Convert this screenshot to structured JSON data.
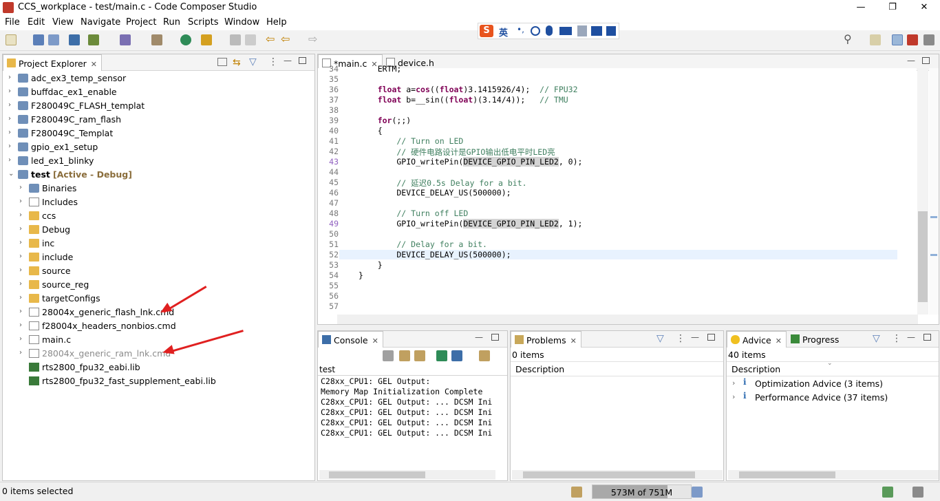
{
  "window": {
    "title": "CCS_workplace - test/main.c - Code Composer Studio"
  },
  "menu": [
    "File",
    "Edit",
    "View",
    "Navigate",
    "Project",
    "Run",
    "Scripts",
    "Window",
    "Help"
  ],
  "project_explorer": {
    "tab_label": "Project Explorer",
    "items": [
      {
        "label": "adc_ex3_temp_sensor",
        "level": 0,
        "icon": "project-icon"
      },
      {
        "label": "buffdac_ex1_enable",
        "level": 0,
        "icon": "project-icon"
      },
      {
        "label": "F280049C_FLASH_templat",
        "level": 0,
        "icon": "project-icon"
      },
      {
        "label": "F280049C_ram_flash",
        "level": 0,
        "icon": "project-icon"
      },
      {
        "label": "F280049C_Templat",
        "level": 0,
        "icon": "project-icon"
      },
      {
        "label": "gpio_ex1_setup",
        "level": 0,
        "icon": "project-icon"
      },
      {
        "label": "led_ex1_blinky",
        "level": 0,
        "icon": "project-icon"
      },
      {
        "label": "test",
        "level": 0,
        "icon": "project-icon",
        "suffix": "[Active - Debug]",
        "expanded": true
      },
      {
        "label": "Binaries",
        "level": 1,
        "icon": "binaries-icon"
      },
      {
        "label": "Includes",
        "level": 1,
        "icon": "includes-icon"
      },
      {
        "label": "ccs",
        "level": 1,
        "icon": "folder-icon"
      },
      {
        "label": "Debug",
        "level": 1,
        "icon": "folder-icon"
      },
      {
        "label": "inc",
        "level": 1,
        "icon": "folder-icon"
      },
      {
        "label": "include",
        "level": 1,
        "icon": "folder-icon"
      },
      {
        "label": "source",
        "level": 1,
        "icon": "folder-icon"
      },
      {
        "label": "source_reg",
        "level": 1,
        "icon": "folder-icon"
      },
      {
        "label": "targetConfigs",
        "level": 1,
        "icon": "folder-icon"
      },
      {
        "label": "28004x_generic_flash_lnk.cmd",
        "level": 1,
        "icon": "cmd-file-icon"
      },
      {
        "label": "f28004x_headers_nonbios.cmd",
        "level": 1,
        "icon": "cmd-file-icon"
      },
      {
        "label": "main.c",
        "level": 1,
        "icon": "c-file-icon"
      },
      {
        "label": "28004x_generic_ram_lnk.cmd",
        "level": 1,
        "icon": "cmd-file-icon",
        "greyed": true
      },
      {
        "label": "rts2800_fpu32_eabi.lib",
        "level": 1,
        "icon": "lib-icon",
        "noarrow": true
      },
      {
        "label": "rts2800_fpu32_fast_supplement_eabi.lib",
        "level": 1,
        "icon": "lib-icon",
        "noarrow": true
      }
    ]
  },
  "editor": {
    "tabs": [
      "*main.c",
      "device.h"
    ],
    "lines": [
      {
        "n": "34",
        "text": "    ERTM;"
      },
      {
        "n": "35",
        "text": ""
      },
      {
        "n": "36",
        "parts": [
          [
            "kw",
            "    float"
          ],
          [
            "",
            " a="
          ],
          [
            "kw",
            "cos"
          ],
          [
            "",
            "(("
          ],
          [
            "kw",
            "float"
          ],
          [
            "",
            ")3.1415926/4);  "
          ],
          [
            "cm",
            "// FPU32"
          ]
        ]
      },
      {
        "n": "37",
        "parts": [
          [
            "kw",
            "    float"
          ],
          [
            "",
            " b=__sin(("
          ],
          [
            "kw",
            "float"
          ],
          [
            "",
            ")(3.14/4));   "
          ],
          [
            "cm",
            "// TMU"
          ]
        ]
      },
      {
        "n": "38",
        "text": ""
      },
      {
        "n": "39",
        "parts": [
          [
            "kw",
            "    for"
          ],
          [
            "",
            "(;;)"
          ]
        ]
      },
      {
        "n": "40",
        "text": "    {"
      },
      {
        "n": "41",
        "parts": [
          [
            "cm",
            "        // Turn on LED"
          ]
        ]
      },
      {
        "n": "42",
        "parts": [
          [
            "cm",
            "        // 硬件电路设计是GPIO输出低电平时LED亮"
          ]
        ]
      },
      {
        "n": "43",
        "parts": [
          [
            "",
            "        GPIO_writePin("
          ],
          [
            "hl",
            "DEVICE_GPIO_PIN_LED2"
          ],
          [
            "",
            ", 0);"
          ]
        ]
      },
      {
        "n": "44",
        "text": ""
      },
      {
        "n": "45",
        "parts": [
          [
            "cm",
            "        // 延迟0.5s Delay for a bit."
          ]
        ]
      },
      {
        "n": "46",
        "text": "        DEVICE_DELAY_US(500000);"
      },
      {
        "n": "47",
        "text": ""
      },
      {
        "n": "48",
        "parts": [
          [
            "cm",
            "        // Turn off LED"
          ]
        ]
      },
      {
        "n": "49",
        "parts": [
          [
            "",
            "        GPIO_writePin("
          ],
          [
            "hl",
            "DEVICE_GPIO_PIN_LED2"
          ],
          [
            "",
            ", 1);"
          ]
        ]
      },
      {
        "n": "50",
        "text": ""
      },
      {
        "n": "51",
        "parts": [
          [
            "cm",
            "        // Delay for a bit."
          ]
        ]
      },
      {
        "n": "52",
        "text": "        DEVICE_DELAY_US(500000);"
      },
      {
        "n": "53",
        "text": "    }"
      },
      {
        "n": "54",
        "text": "}"
      },
      {
        "n": "55",
        "text": ""
      },
      {
        "n": "56",
        "text": ""
      },
      {
        "n": "57",
        "text": ""
      }
    ]
  },
  "console": {
    "tab_label": "Console",
    "context": "test",
    "lines": [
      "C28xx_CPU1: GEL Output:",
      "Memory Map Initialization Complete",
      "C28xx_CPU1: GEL Output: ... DCSM Ini",
      "C28xx_CPU1: GEL Output: ... DCSM Ini",
      "C28xx_CPU1: GEL Output: ... DCSM Ini",
      "C28xx_CPU1: GEL Output: ... DCSM Ini"
    ]
  },
  "problems": {
    "tab_label": "Problems",
    "count": "0 items",
    "header": "Description"
  },
  "advice": {
    "tab_label": "Advice",
    "progress_tab_label": "Progress",
    "count": "40 items",
    "header": "Description",
    "items": [
      "Optimization Advice (3 items)",
      "Performance Advice (37 items)"
    ]
  },
  "status": {
    "selection": "0 items selected",
    "heap": "573M of 751M",
    "heap_fraction": 0.763
  },
  "ime": {
    "label": "英"
  },
  "colors": {
    "accent": "#2d6bb0",
    "active_label": "#8a6d3b",
    "annotation_arrow": "#e02020"
  }
}
